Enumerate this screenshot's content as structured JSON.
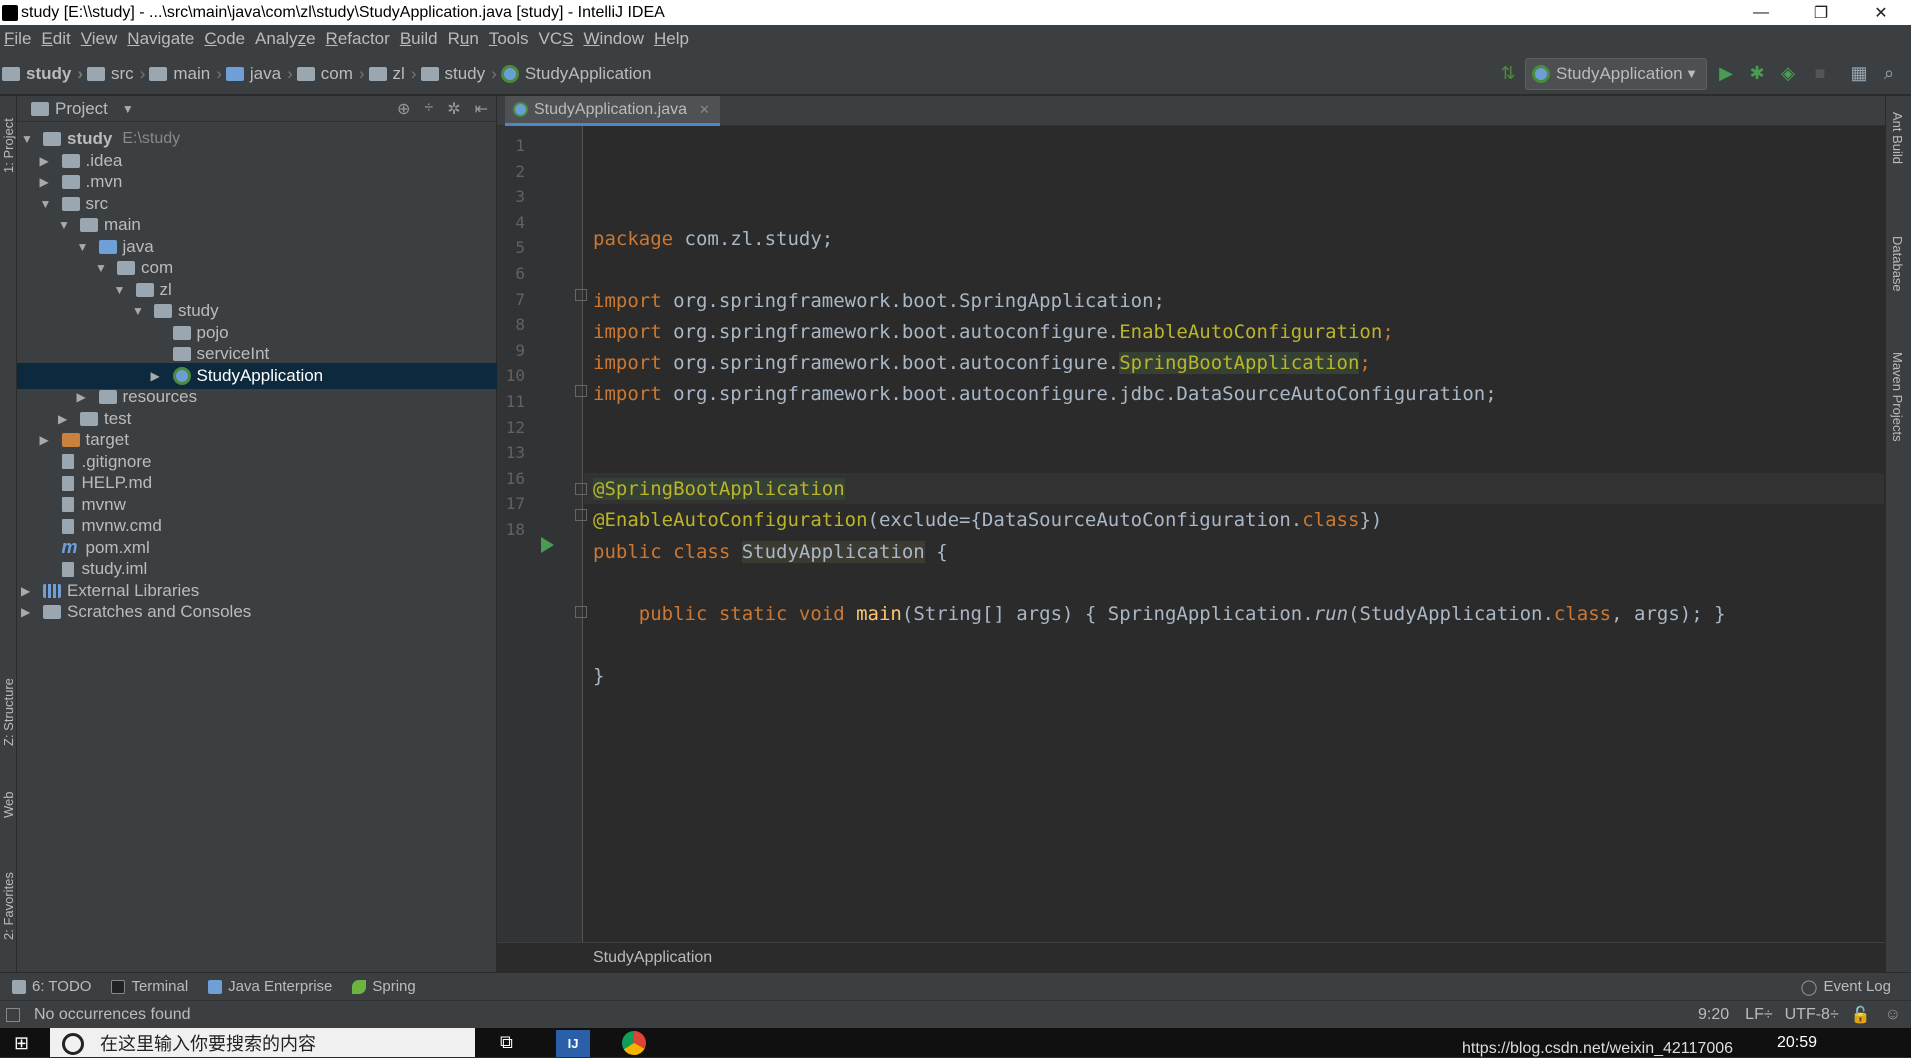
{
  "window": {
    "title": "study [E:\\\\study] - ...\\src\\main\\java\\com\\zl\\study\\StudyApplication.java [study] - IntelliJ IDEA",
    "controls": [
      "—",
      "❐",
      "✕"
    ]
  },
  "menu": [
    {
      "u": "F",
      "rest": "ile"
    },
    {
      "u": "E",
      "rest": "dit"
    },
    {
      "u": "V",
      "rest": "iew"
    },
    {
      "u": "N",
      "rest": "avigate"
    },
    {
      "u": "C",
      "rest": "ode"
    },
    {
      "pre": "Analy",
      "u": "z",
      "rest": "e"
    },
    {
      "u": "R",
      "rest": "efactor"
    },
    {
      "u": "B",
      "rest": "uild"
    },
    {
      "pre": "R",
      "u": "u",
      "rest": "n"
    },
    {
      "u": "T",
      "rest": "ools"
    },
    {
      "pre": "VC",
      "u": "S",
      "rest": ""
    },
    {
      "u": "W",
      "rest": "indow"
    },
    {
      "u": "H",
      "rest": "elp"
    }
  ],
  "breadcrumb": [
    "study",
    "src",
    "main",
    "java",
    "com",
    "zl",
    "study",
    "StudyApplication"
  ],
  "run_config": {
    "label": "StudyApplication"
  },
  "project_panel": {
    "title": "Project",
    "tree": [
      {
        "label": "study",
        "extra": "E:\\study",
        "indent": 0,
        "tri": "▼",
        "icon": "grey",
        "bold": true
      },
      {
        "label": ".idea",
        "indent": 1,
        "tri": "▶",
        "icon": "grey"
      },
      {
        "label": ".mvn",
        "indent": 1,
        "tri": "▶",
        "icon": "grey"
      },
      {
        "label": "src",
        "indent": 1,
        "tri": "▼",
        "icon": "grey"
      },
      {
        "label": "main",
        "indent": 2,
        "tri": "▼",
        "icon": "grey"
      },
      {
        "label": "java",
        "indent": 3,
        "tri": "▼",
        "icon": "blue"
      },
      {
        "label": "com",
        "indent": 4,
        "tri": "▼",
        "icon": "grey"
      },
      {
        "label": "zl",
        "indent": 5,
        "tri": "▼",
        "icon": "grey"
      },
      {
        "label": "study",
        "indent": 6,
        "tri": "▼",
        "icon": "grey"
      },
      {
        "label": "pojo",
        "indent": 7,
        "tri": "",
        "icon": "grey"
      },
      {
        "label": "serviceInt",
        "indent": 7,
        "tri": "",
        "icon": "grey"
      },
      {
        "label": "StudyApplication",
        "indent": 7,
        "tri": "▶",
        "icon": "spring",
        "selected": true
      },
      {
        "label": "resources",
        "indent": 3,
        "tri": "▶",
        "icon": "grey"
      },
      {
        "label": "test",
        "indent": 2,
        "tri": "▶",
        "icon": "grey"
      },
      {
        "label": "target",
        "indent": 1,
        "tri": "▶",
        "icon": "orange"
      },
      {
        "label": ".gitignore",
        "indent": 1,
        "tri": "",
        "icon": "file"
      },
      {
        "label": "HELP.md",
        "indent": 1,
        "tri": "",
        "icon": "file"
      },
      {
        "label": "mvnw",
        "indent": 1,
        "tri": "",
        "icon": "file"
      },
      {
        "label": "mvnw.cmd",
        "indent": 1,
        "tri": "",
        "icon": "file"
      },
      {
        "label": "pom.xml",
        "indent": 1,
        "tri": "",
        "icon": "maven"
      },
      {
        "label": "study.iml",
        "indent": 1,
        "tri": "",
        "icon": "file"
      },
      {
        "label": "External Libraries",
        "indent": 0,
        "tri": "▶",
        "icon": "lib"
      },
      {
        "label": "Scratches and Consoles",
        "indent": 0,
        "tri": "▶",
        "icon": "grey"
      }
    ]
  },
  "editor": {
    "tab": "StudyApplication.java",
    "footer": "StudyApplication",
    "line_numbers": [
      "1",
      "2",
      "3",
      "4",
      "5",
      "6",
      "7",
      "8",
      "9",
      "10",
      "11",
      "12",
      "13",
      "16",
      "17",
      "18"
    ],
    "code": {
      "l1_kw": "package",
      "l1_rest": " com.zl.study;",
      "imp_kw": "import",
      "l3": " org.springframework.boot.SpringApplication;",
      "l4a": " org.springframework.boot.autoconfigure.",
      "l4b": "EnableAutoConfiguration",
      "l4c": ";",
      "l5a": " org.springframework.boot.autoconfigure.",
      "l5b": "SpringBootApplication",
      "l5c": ";",
      "l6": " org.springframework.boot.autoconfigure.jdbc.DataSourceAutoConfiguration;",
      "l9": "@SpringBootApplication",
      "l10a": "@EnableAutoConfiguration",
      "l10b": "(exclude={DataSourceAutoConfiguration.",
      "l10c": "class",
      "l10d": "})",
      "l11a": "public class ",
      "l11b": "StudyApplication",
      "l11c": " {",
      "l13a": "    public static void ",
      "l13b": "main",
      "l13c": "(String[] args) { SpringApplication.",
      "l13d": "run",
      "l13e": "(StudyApplication.",
      "l13f": "class",
      "l13g": ", args); }",
      "l17": "}"
    }
  },
  "left_tabs": [
    "1: Project",
    "Z: Structure",
    "Web",
    "2: Favorites"
  ],
  "right_tabs": [
    "Ant Build",
    "Database",
    "Maven Projects"
  ],
  "tool_tabs": [
    "6: TODO",
    "Terminal",
    "Java Enterprise",
    "Spring"
  ],
  "event_log": "Event Log",
  "status": {
    "message": "No occurrences found",
    "position": "9:20",
    "line_sep": "LF÷",
    "encoding": "UTF-8÷"
  },
  "taskbar": {
    "search_placeholder": "在这里输入你要搜索的内容",
    "time": "20:59",
    "watermark": "https://blog.csdn.net/weixin_42117006"
  }
}
